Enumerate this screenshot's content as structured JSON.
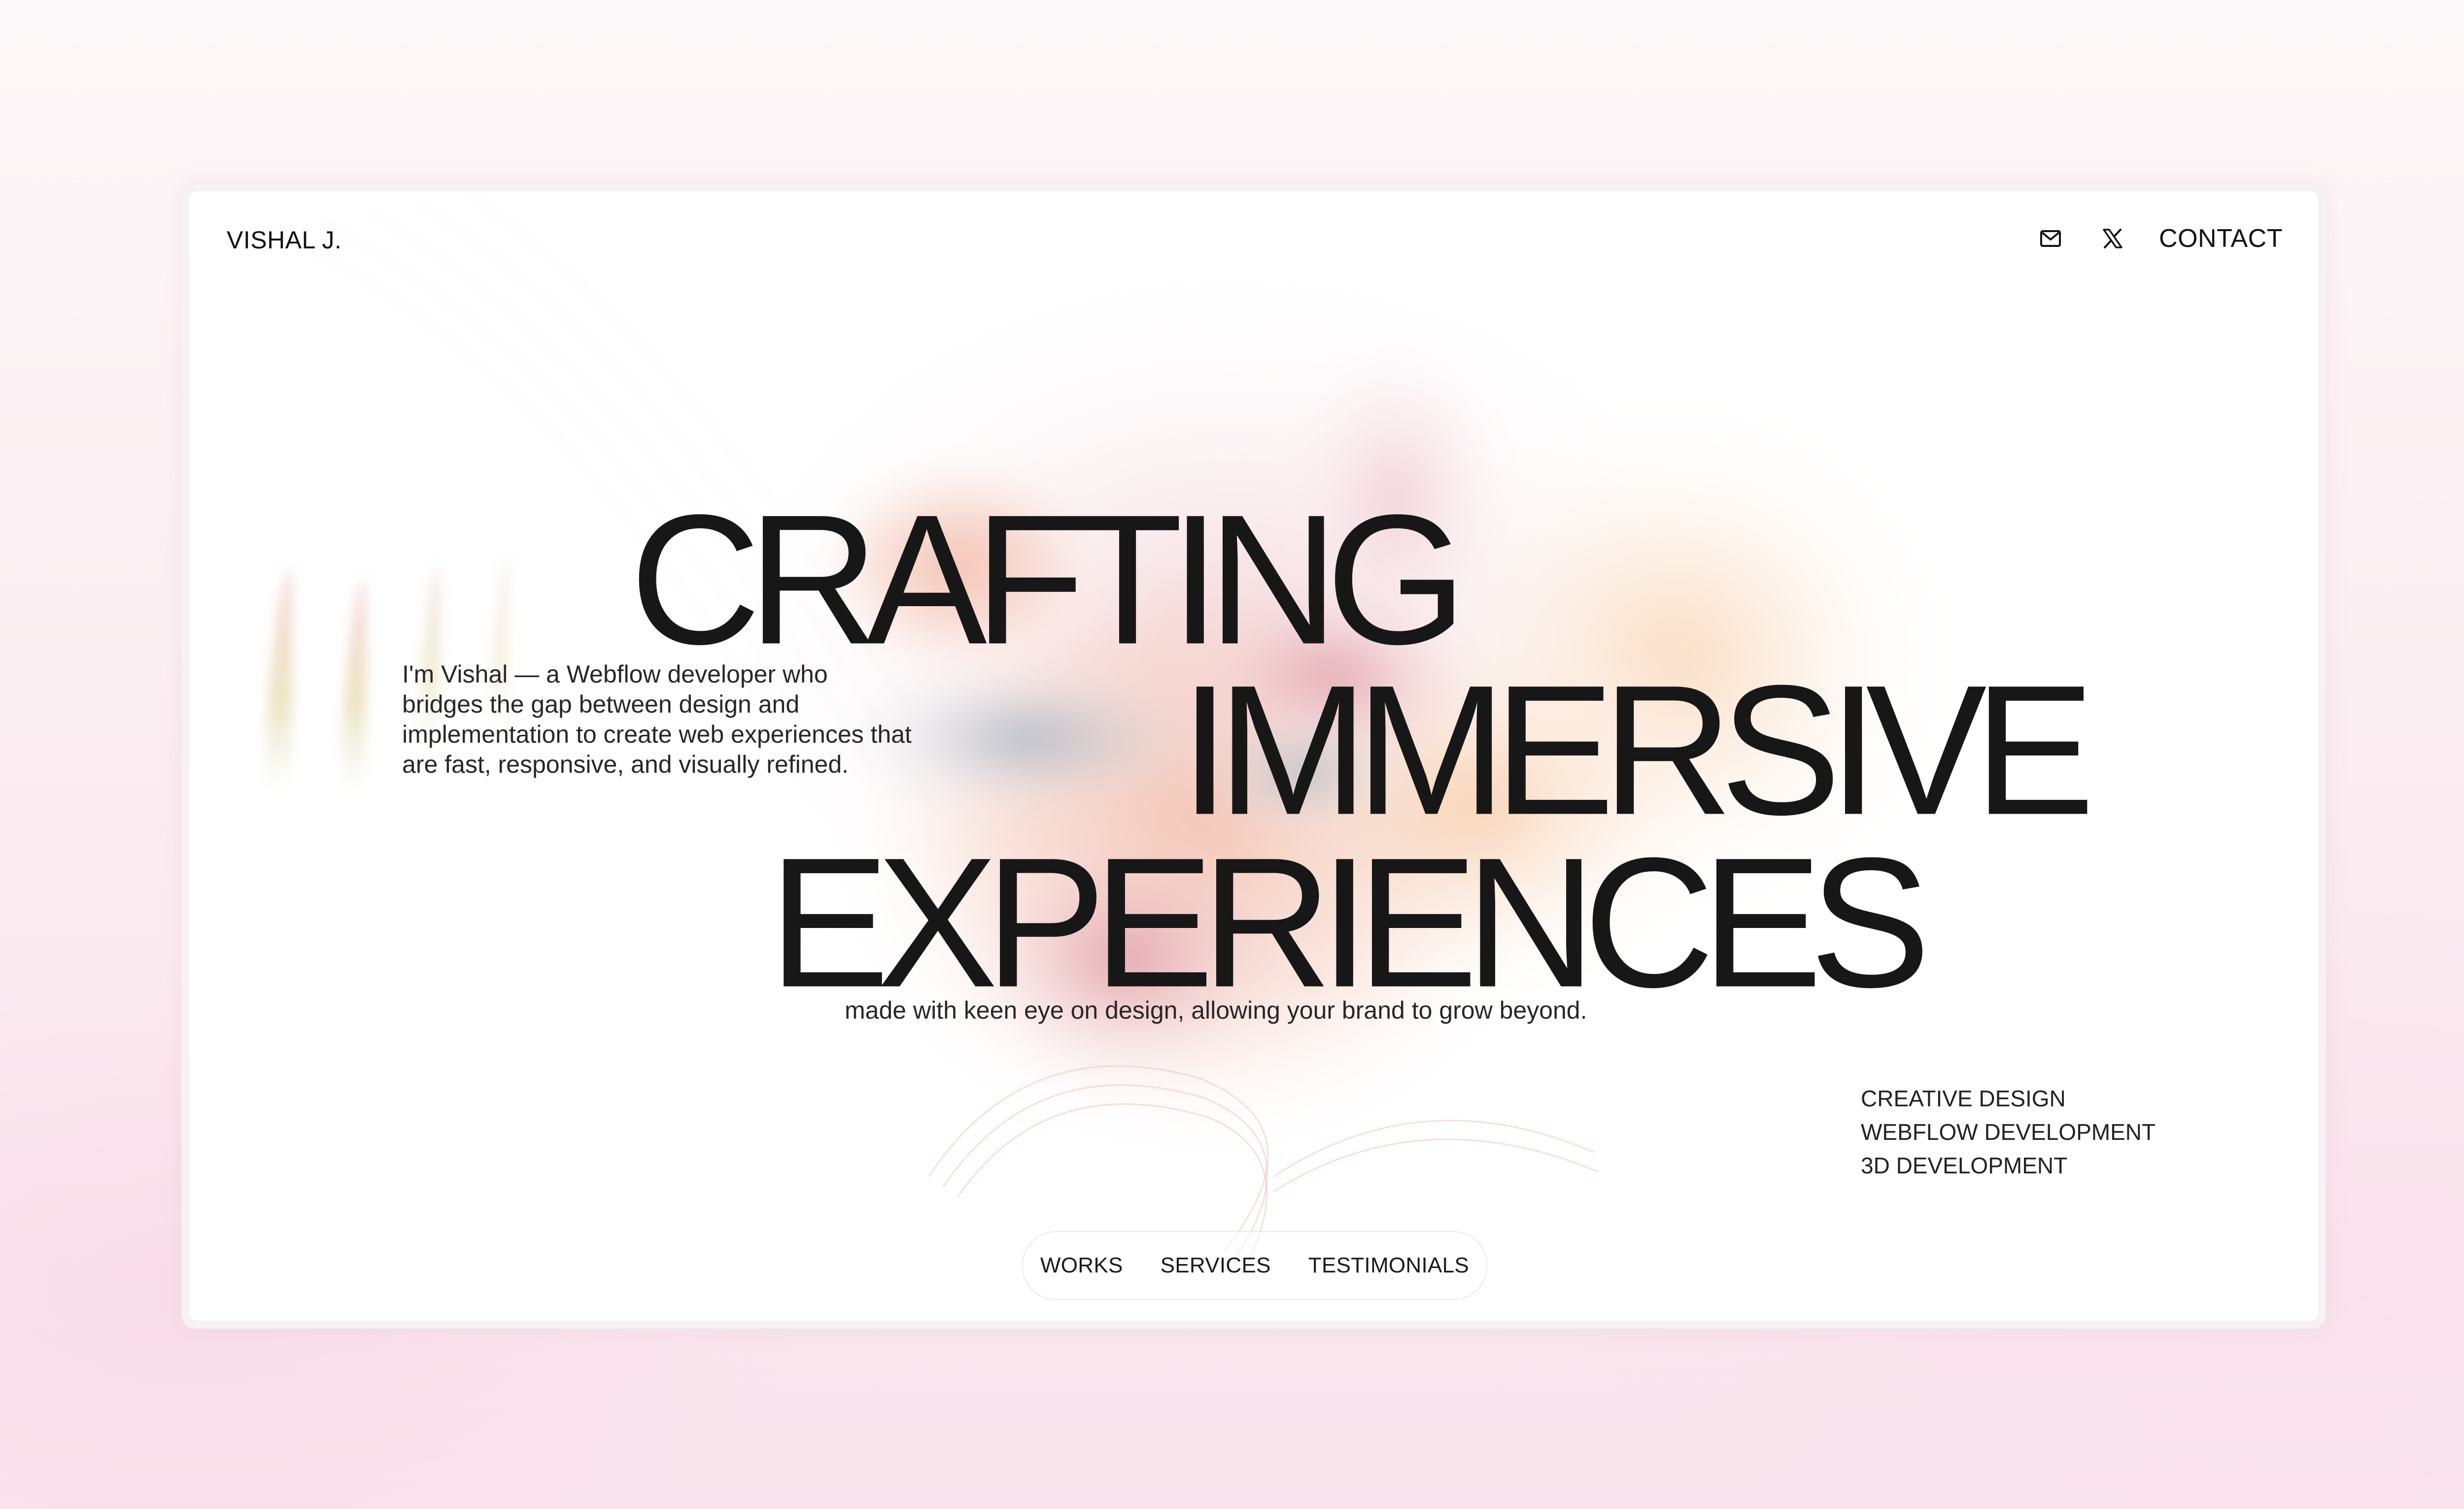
{
  "header": {
    "logo": "VISHAL J.",
    "contact_label": "CONTACT",
    "icons": [
      "mail-icon",
      "x-twitter-icon"
    ]
  },
  "intro": {
    "text": "I'm Vishal — a Webflow developer who bridges the gap between design and implementation to create web experiences that are fast, responsive, and visually refined."
  },
  "hero": {
    "line1": "CRAFTING",
    "line2": "IMMERSIVE",
    "line3": "EXPERIENCES",
    "tagline": "made with keen eye on design, allowing your brand to grow beyond."
  },
  "services": {
    "items": [
      "CREATIVE DESIGN",
      "WEBFLOW DEVELOPMENT",
      "3D DEVELOPMENT"
    ]
  },
  "bottom_nav": {
    "items": [
      "WORKS",
      "SERVICES",
      "TESTIMONIALS"
    ]
  },
  "colors": {
    "text": "#171717",
    "page_bg": "#fbeef2",
    "card_bg": "#ffffff"
  }
}
